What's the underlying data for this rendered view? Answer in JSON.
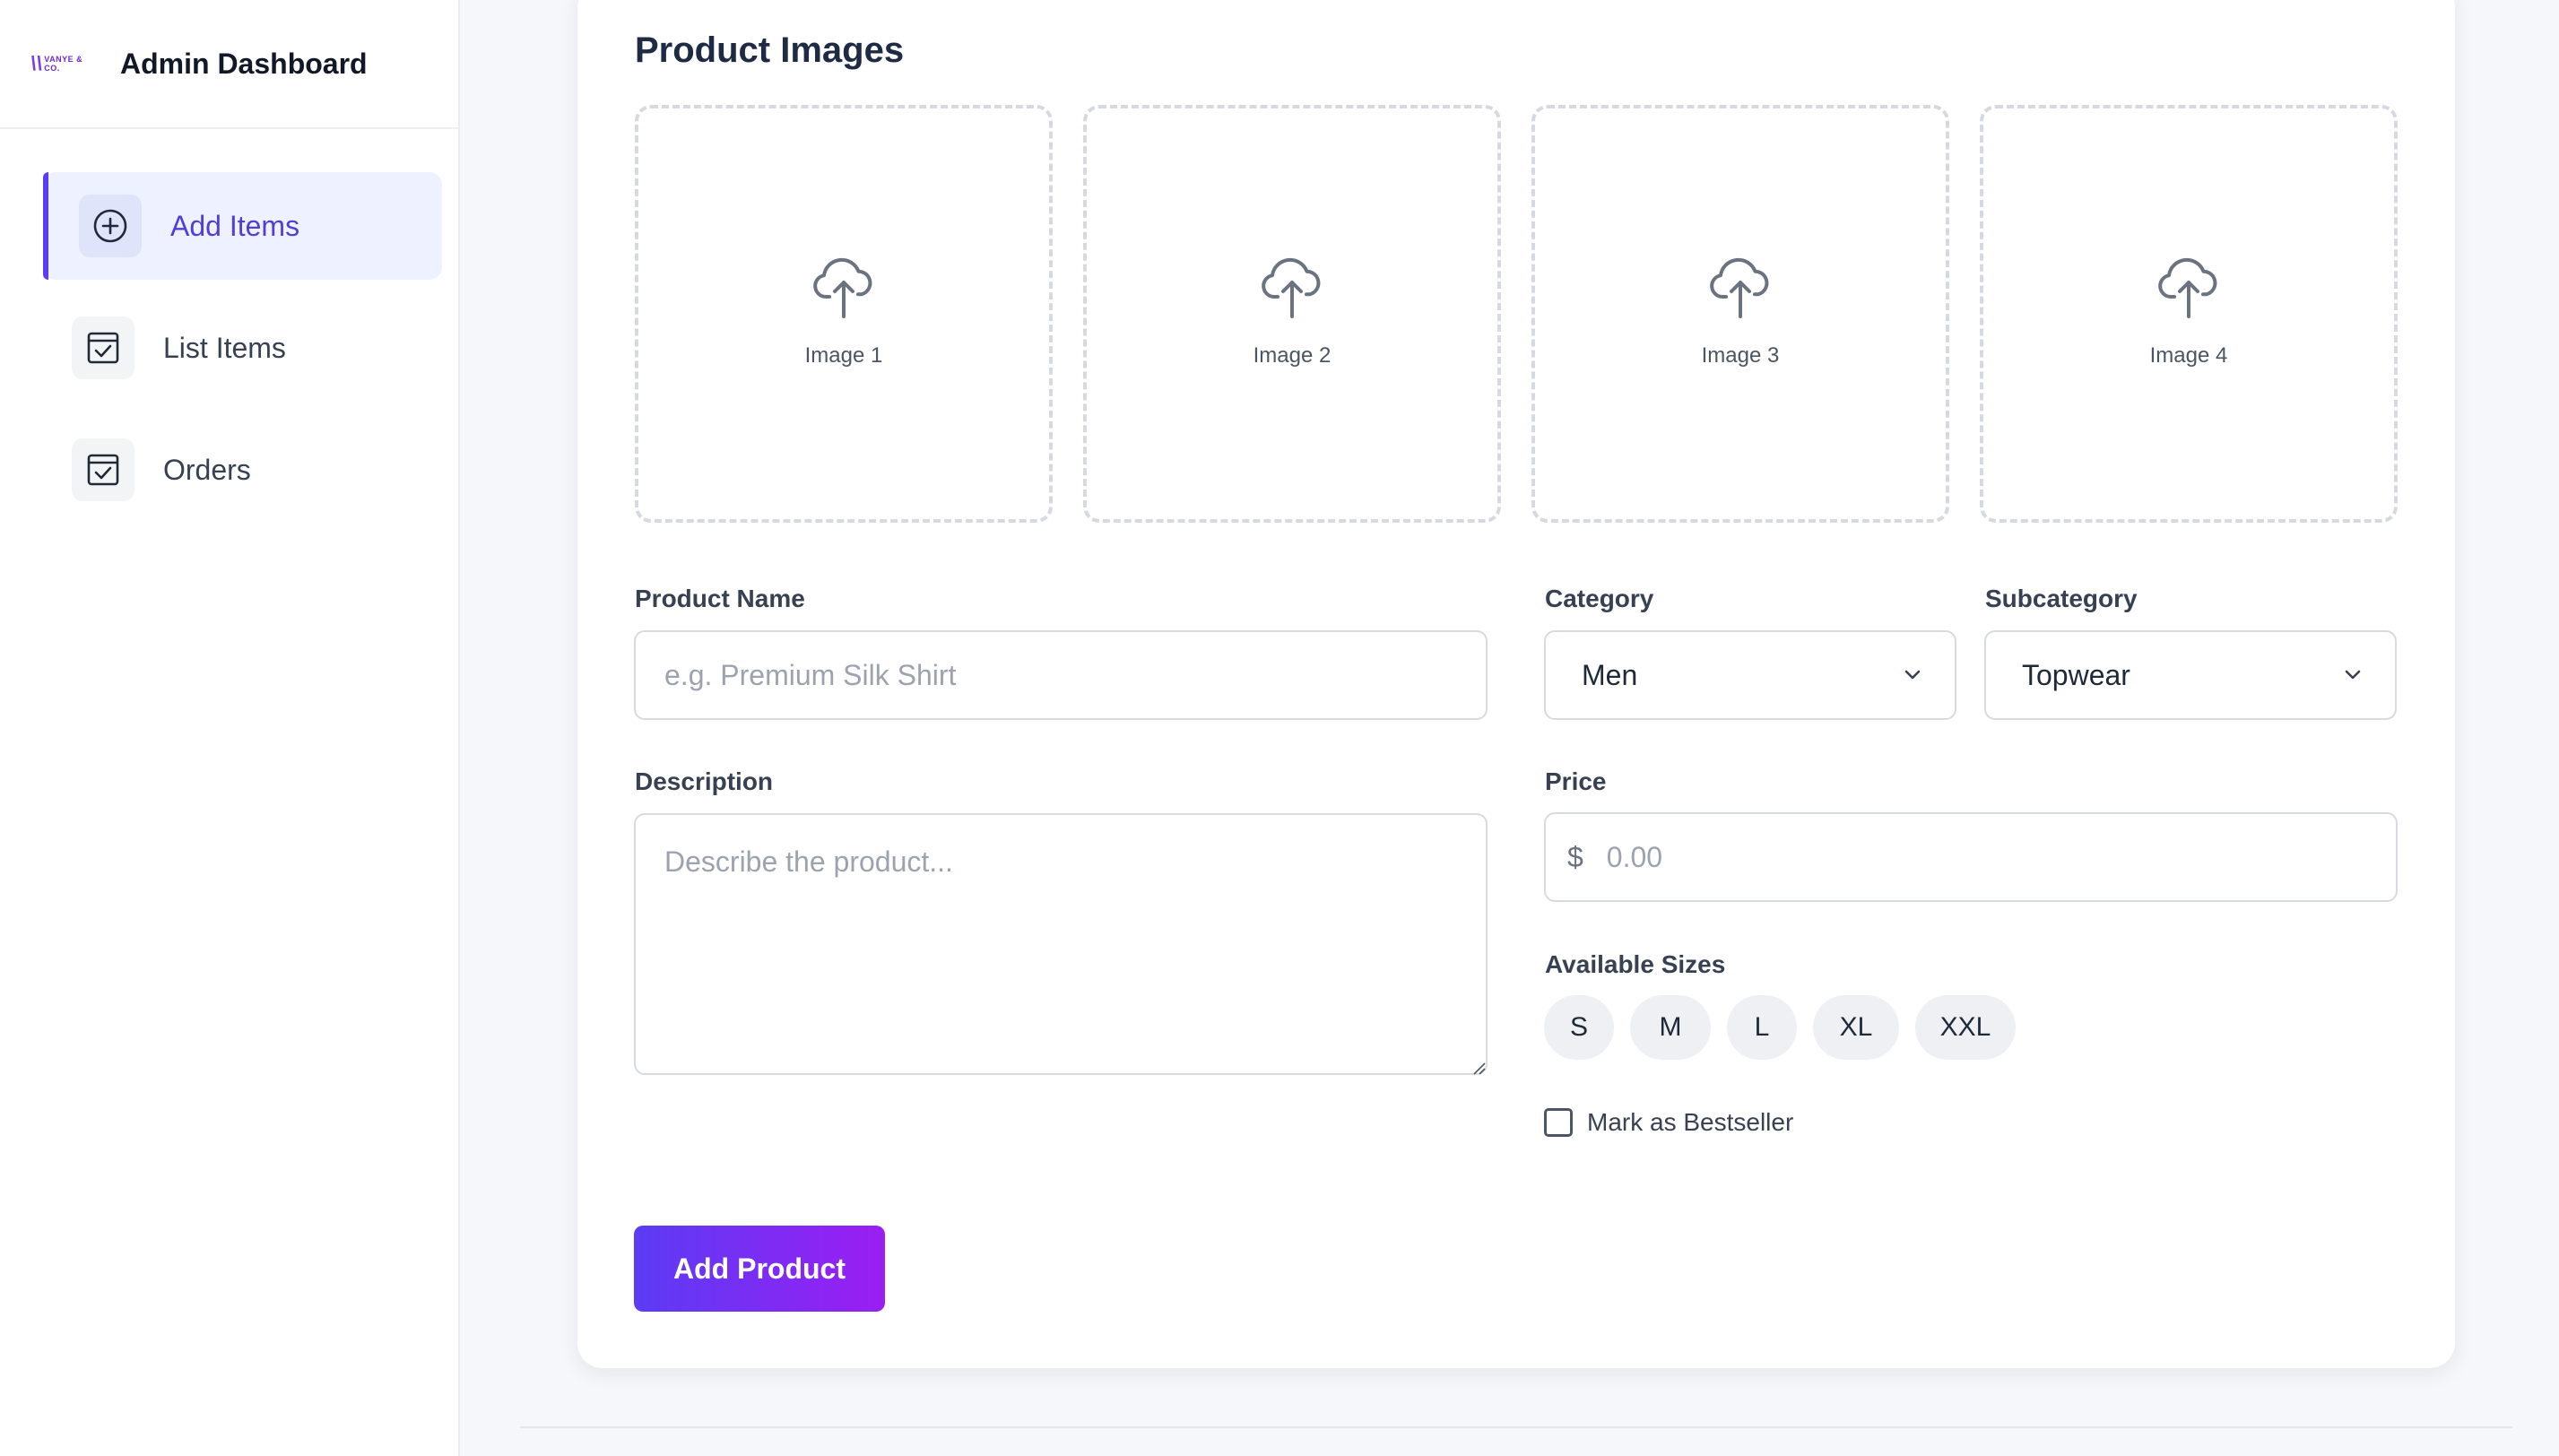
{
  "brand": {
    "logo_text": "VANYE & CO.",
    "title": "Admin Dashboard"
  },
  "sidebar": {
    "items": [
      {
        "label": "Add Items",
        "icon": "plus-circle-icon",
        "active": true
      },
      {
        "label": "List Items",
        "icon": "calendar-check-icon",
        "active": false
      },
      {
        "label": "Orders",
        "icon": "calendar-check-icon",
        "active": false
      }
    ]
  },
  "form": {
    "images_title": "Product Images",
    "image_slots": [
      "Image 1",
      "Image 2",
      "Image 3",
      "Image 4"
    ],
    "product_name": {
      "label": "Product Name",
      "placeholder": "e.g. Premium Silk Shirt",
      "value": ""
    },
    "category": {
      "label": "Category",
      "value": "Men"
    },
    "subcategory": {
      "label": "Subcategory",
      "value": "Topwear"
    },
    "description": {
      "label": "Description",
      "placeholder": "Describe the product...",
      "value": ""
    },
    "price": {
      "label": "Price",
      "currency": "$",
      "placeholder": "0.00",
      "value": ""
    },
    "sizes": {
      "label": "Available Sizes",
      "options": [
        "S",
        "M",
        "L",
        "XL",
        "XXL"
      ]
    },
    "bestseller": {
      "label": "Mark as Bestseller",
      "checked": false
    },
    "submit_label": "Add Product"
  },
  "colors": {
    "accent": "#5b3cf5",
    "accent_end": "#9b1ef2",
    "active_bg": "#eef1ff"
  }
}
